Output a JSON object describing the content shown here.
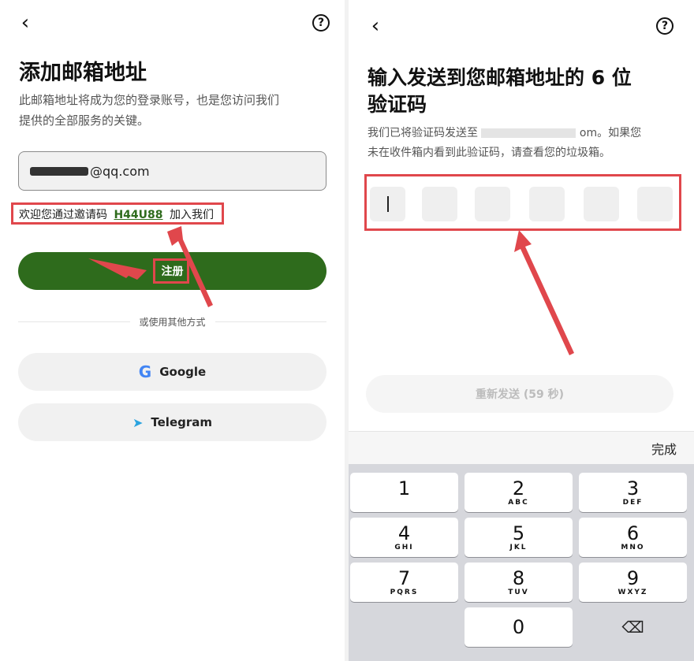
{
  "left": {
    "back_icon": "‹",
    "help_icon": "?",
    "title": "添加邮箱地址",
    "desc_line1": "此邮箱地址将成为您的登录账号，也是您访问我们",
    "desc_line2": "提供的全部服务的关键。",
    "email_value": "@qq.com",
    "invite_prefix": "欢迎您通过邀请码",
    "invite_code": "H44U88",
    "invite_suffix": "加入我们",
    "register_label": "注册",
    "or_text": "或使用其他方式",
    "google_label": "Google",
    "google_icon": "G",
    "telegram_label": "Telegram",
    "telegram_icon": "➤"
  },
  "right": {
    "back_icon": "‹",
    "help_icon": "?",
    "title_line1": "输入发送到您邮箱地址的 6 位",
    "title_line2": "验证码",
    "desc_line1a": "我们已将验证码发送至",
    "desc_line1b": "om。如果您",
    "desc_line2": "未在收件箱内看到此验证码，请查看您的垃圾箱。",
    "resend_label": "重新发送 (59 秒)",
    "done_label": "完成",
    "keys": [
      {
        "num": "1",
        "letters": ""
      },
      {
        "num": "2",
        "letters": "ABC"
      },
      {
        "num": "3",
        "letters": "DEF"
      },
      {
        "num": "4",
        "letters": "GHI"
      },
      {
        "num": "5",
        "letters": "JKL"
      },
      {
        "num": "6",
        "letters": "MNO"
      },
      {
        "num": "7",
        "letters": "PQRS"
      },
      {
        "num": "8",
        "letters": "TUV"
      },
      {
        "num": "9",
        "letters": "WXYZ"
      },
      {
        "num": "0",
        "letters": ""
      }
    ],
    "delete_icon": "⌫"
  },
  "colors": {
    "brand_green": "#2e6b1c",
    "highlight_red": "#e0474c"
  }
}
